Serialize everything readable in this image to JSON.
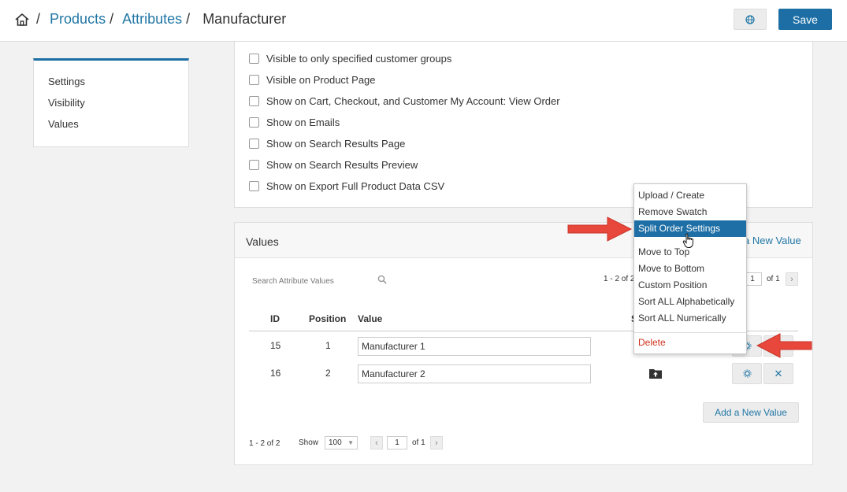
{
  "breadcrumb": {
    "items": [
      "Products",
      "Attributes"
    ],
    "current": "Manufacturer",
    "separator": "/"
  },
  "header": {
    "save_label": "Save",
    "language_icon": "globe-icon",
    "home_icon": "home-icon"
  },
  "sidebar": {
    "items": [
      {
        "label": "Settings"
      },
      {
        "label": "Visibility"
      },
      {
        "label": "Values"
      }
    ]
  },
  "visibility": {
    "options": [
      {
        "label": "Visible to only specified customer groups",
        "checked": false
      },
      {
        "label": "Visible on Product Page",
        "checked": false
      },
      {
        "label": "Show on Cart, Checkout, and Customer My Account: View Order",
        "checked": false
      },
      {
        "label": "Show on Emails",
        "checked": false
      },
      {
        "label": "Show on Search Results Page",
        "checked": false
      },
      {
        "label": "Show on Search Results Preview",
        "checked": false
      },
      {
        "label": "Show on Export Full Product Data CSV",
        "checked": false
      }
    ]
  },
  "values_panel": {
    "title": "Values",
    "add_link_top": "a New Value",
    "search_placeholder": "Search Attribute Values",
    "top_range": "1 - 2 of 2",
    "page_value": "1",
    "of_pages": "of 1",
    "columns": {
      "id": "ID",
      "position": "Position",
      "value": "Value",
      "swatch": "S"
    },
    "rows": [
      {
        "id": "15",
        "position": "1",
        "value": "Manufacturer 1"
      },
      {
        "id": "16",
        "position": "2",
        "value": "Manufacturer 2"
      }
    ],
    "add_button": "Add a New Value",
    "bottom_range": "1 - 2 of 2",
    "show_label": "Show",
    "show_value": "100",
    "bottom_page_value": "1",
    "bottom_of_pages": "of 1"
  },
  "context_menu": {
    "items": [
      {
        "label": "Upload / Create",
        "active": false
      },
      {
        "label": "Remove Swatch",
        "active": false
      },
      {
        "label": "Split Order Settings",
        "active": true
      },
      {
        "label": "Move to Top",
        "active": false
      },
      {
        "label": "Move to Bottom",
        "active": false
      },
      {
        "label": "Custom Position",
        "active": false
      },
      {
        "label": "Sort ALL Alphabetically",
        "active": false
      },
      {
        "label": "Sort ALL Numerically",
        "active": false
      }
    ],
    "delete_label": "Delete"
  },
  "colors": {
    "primary": "#1c6ea4",
    "link": "#2277a5",
    "danger": "#d0321f",
    "annotation_arrow": "#e8473b"
  }
}
